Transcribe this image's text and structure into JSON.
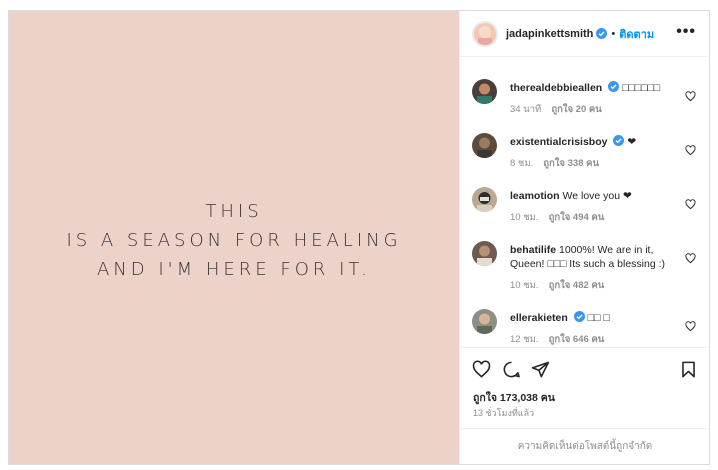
{
  "post": {
    "quote_lines": [
      "THIS",
      "IS A SEASON FOR HEALING",
      "AND I'M HERE FOR IT."
    ]
  },
  "header": {
    "username": "jadapinkettsmith",
    "dot": "•",
    "follow_label": "ติดตาม",
    "more_label": "•••"
  },
  "comments": [
    {
      "user": "therealdebbieallen",
      "verified": true,
      "text": "□□□□□□",
      "time": "34 นาที",
      "likes": "ถูกใจ 20 คน",
      "avatar_color": "#4a3f38"
    },
    {
      "user": "existentialcrisisboy",
      "verified": true,
      "text": "❤",
      "time": "8 ชม.",
      "likes": "ถูกใจ 338 คน",
      "avatar_color": "#5c4a3a"
    },
    {
      "user": "leamotion",
      "verified": false,
      "text": "We love you ❤",
      "time": "10 ชม.",
      "likes": "ถูกใจ 494 คน",
      "avatar_color": "#b9a892"
    },
    {
      "user": "behatilife",
      "verified": false,
      "text": "1000%! We are in it, Queen! □□□ Its such a blessing :)",
      "time": "10 ชม.",
      "likes": "ถูกใจ 482 คน",
      "avatar_color": "#6e5a4e"
    },
    {
      "user": "ellerakieten",
      "verified": true,
      "text": "□□ □",
      "time": "12 ชม.",
      "likes": "ถูกใจ 646 คน",
      "avatar_color": "#8d8f86"
    }
  ],
  "footer": {
    "likes_total": "ถูกใจ 173,038 คน",
    "timestamp": "13 ชั่วโมงที่แล้ว",
    "comments_limited": "ความคิดเห็นต่อโพสต์นี้ถูกจำกัด"
  },
  "icons": {
    "verified": "verified-badge-icon",
    "heart": "heart-icon",
    "comment": "comment-icon",
    "share": "share-icon",
    "save": "bookmark-icon",
    "more": "more-options-icon"
  },
  "colors": {
    "image_background": "#ecd2c9",
    "follow_blue": "#0095f6",
    "verified_blue": "#3897f0",
    "muted_text": "#8e8e8e"
  }
}
